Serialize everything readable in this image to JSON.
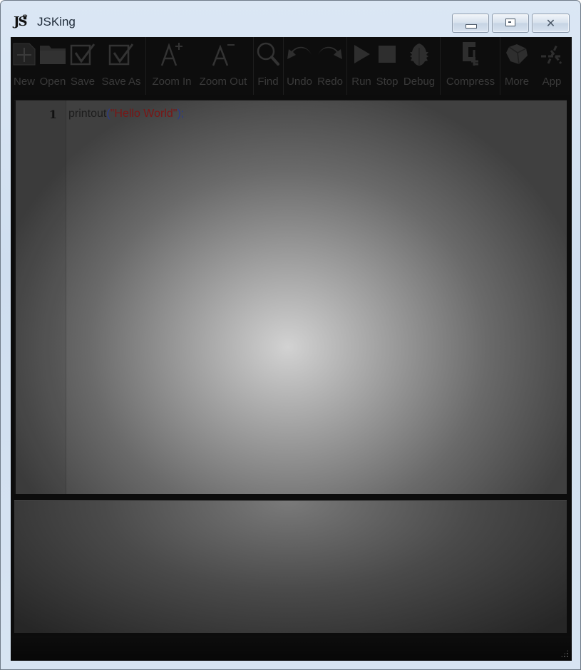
{
  "window": {
    "title": "JSKing",
    "app_icon_text": "JS",
    "controls": {
      "minimize": "minimize",
      "maximize": "maximize",
      "close": "✕"
    }
  },
  "toolbar": {
    "items": [
      {
        "id": "new",
        "label": "New",
        "icon": "new-file-icon"
      },
      {
        "id": "open",
        "label": "Open",
        "icon": "folder-icon"
      },
      {
        "id": "save",
        "label": "Save",
        "icon": "save-check-icon"
      },
      {
        "id": "save-as",
        "label": "Save As",
        "icon": "save-as-check-icon"
      },
      {
        "id": "zoom-in",
        "label": "Zoom In",
        "icon": "font-increase-icon"
      },
      {
        "id": "zoom-out",
        "label": "Zoom Out",
        "icon": "font-decrease-icon"
      },
      {
        "id": "find",
        "label": "Find",
        "icon": "magnifier-icon"
      },
      {
        "id": "undo",
        "label": "Undo",
        "icon": "undo-arrow-icon"
      },
      {
        "id": "redo",
        "label": "Redo",
        "icon": "redo-arrow-icon"
      },
      {
        "id": "run",
        "label": "Run",
        "icon": "play-icon"
      },
      {
        "id": "stop",
        "label": "Stop",
        "icon": "stop-square-icon"
      },
      {
        "id": "debug",
        "label": "Debug",
        "icon": "bug-icon"
      },
      {
        "id": "compress",
        "label": "Compress",
        "icon": "clamp-icon"
      },
      {
        "id": "more",
        "label": "More",
        "icon": "package-box-icon"
      },
      {
        "id": "app",
        "label": "App",
        "icon": "app-store-icon"
      }
    ]
  },
  "editor": {
    "lines": [
      {
        "number": "1",
        "tokens": {
          "fn": "printout",
          "open_paren": "(",
          "string": "\"Hello World\"",
          "close": ");"
        }
      }
    ]
  },
  "console": {
    "output": ""
  },
  "statusbar": {
    "text": ""
  }
}
